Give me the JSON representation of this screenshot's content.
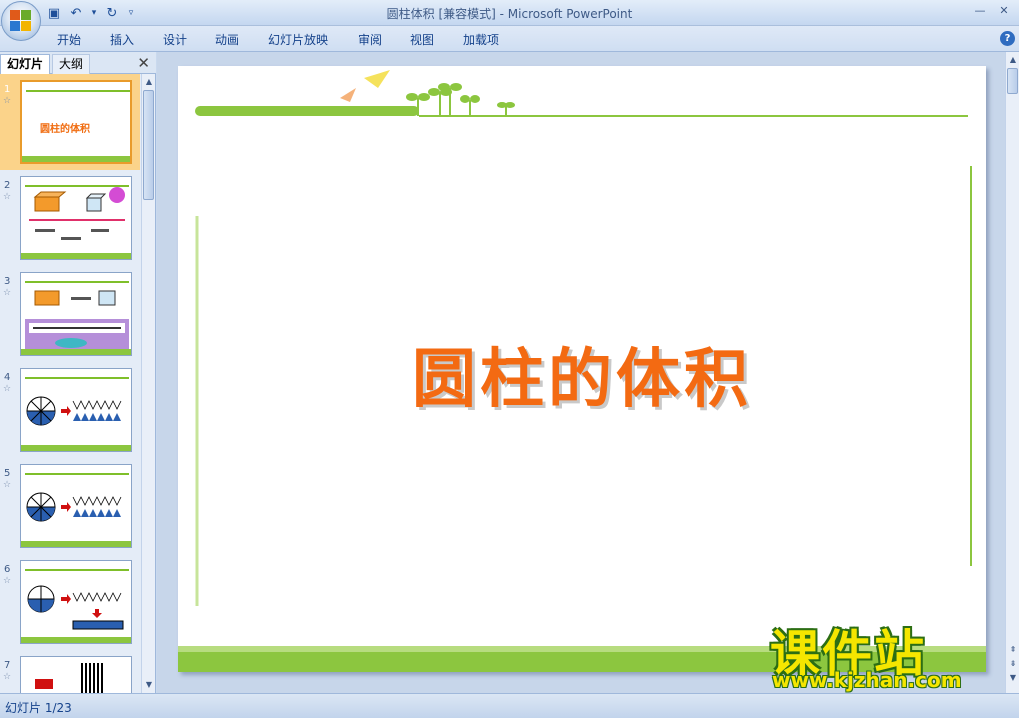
{
  "window": {
    "title": "圆柱体积 [兼容模式] - Microsoft PowerPoint",
    "minimize_glyph": "—",
    "close_glyph": "✕"
  },
  "quick_access": [
    {
      "icon": "save-icon",
      "glyph": "▣"
    },
    {
      "icon": "undo-icon",
      "glyph": "↶"
    },
    {
      "icon": "dropdown-icon",
      "glyph": "▾"
    },
    {
      "icon": "redo-icon",
      "glyph": "↻"
    },
    {
      "icon": "customize-icon",
      "glyph": "▿"
    }
  ],
  "ribbon_tabs": [
    "开始",
    "插入",
    "设计",
    "动画",
    "幻灯片放映",
    "审阅",
    "视图",
    "加载项"
  ],
  "help_glyph": "?",
  "left_panel": {
    "tabs": [
      "幻灯片",
      "大纲"
    ],
    "close_glyph": "✕",
    "thumbnails": [
      {
        "number": "1",
        "title": "圆柱的体积"
      },
      {
        "number": "2",
        "title": ""
      },
      {
        "number": "3",
        "title": ""
      },
      {
        "number": "4",
        "title": ""
      },
      {
        "number": "5",
        "title": ""
      },
      {
        "number": "6",
        "title": ""
      },
      {
        "number": "7",
        "title": ""
      }
    ],
    "selected": 1
  },
  "slide": {
    "title": "圆柱的体积",
    "colors": {
      "title": "#f36a12",
      "accent_green": "#8cc63f"
    }
  },
  "status_bar": {
    "slide_indicator": "幻灯片 1/23"
  },
  "watermark": {
    "text": "课件站",
    "url": "www.kjzhan.com"
  }
}
